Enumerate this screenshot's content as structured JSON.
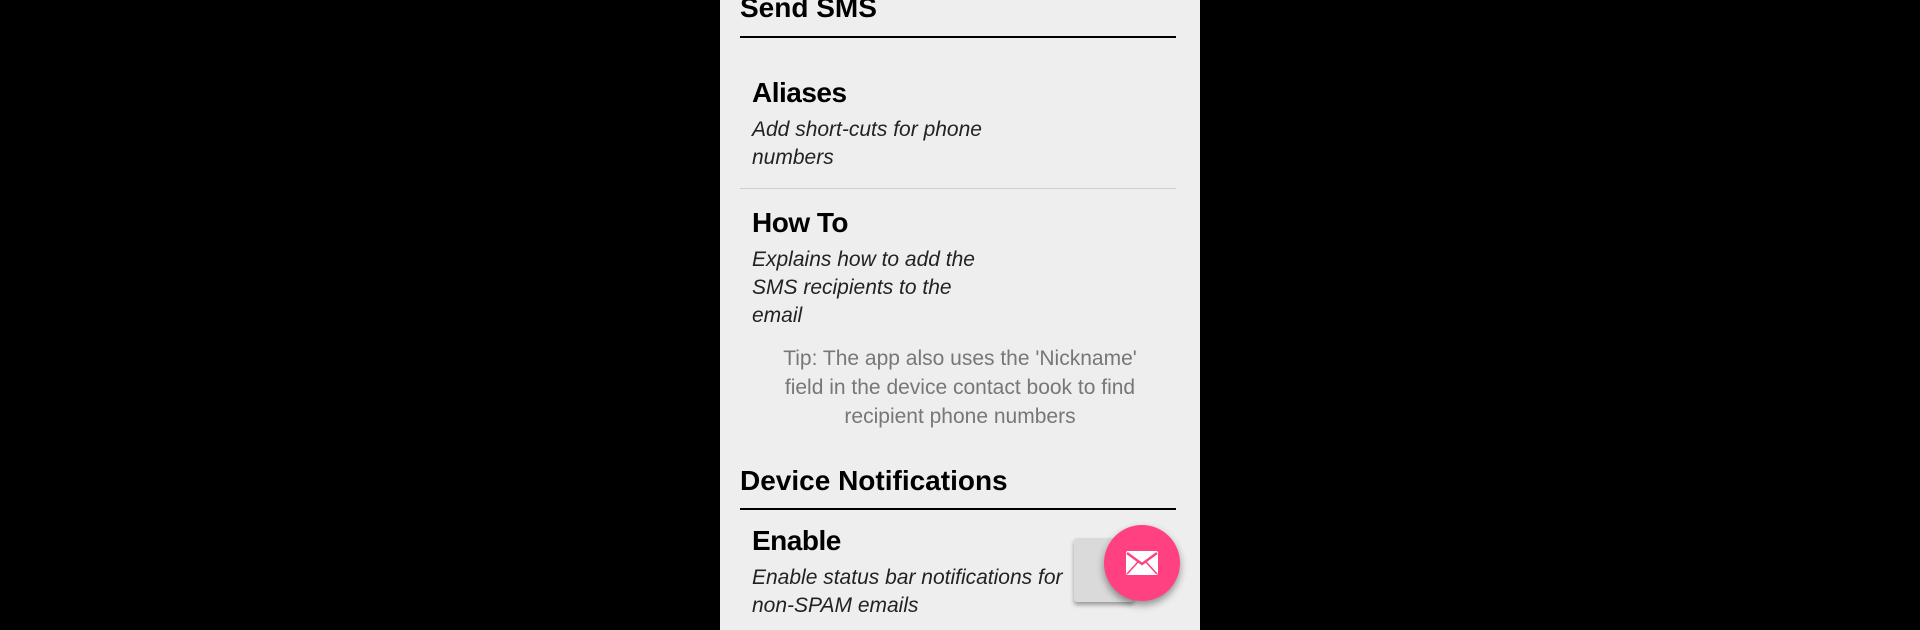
{
  "sections": {
    "send_sms": {
      "title": "Send SMS"
    },
    "device_notifications": {
      "title": "Device Notifications"
    }
  },
  "prefs": {
    "aliases": {
      "title": "Aliases",
      "summary": "Add short-cuts for phone numbers"
    },
    "how_to": {
      "title": "How To",
      "summary": "Explains how to add the SMS recipients to the email"
    },
    "enable": {
      "title": "Enable",
      "summary": "Enable status bar notifications for non-SPAM emails",
      "checked": false
    }
  },
  "tip": "Tip: The app also uses the 'Nickname' field in the device contact book to find recipient phone numbers",
  "fab": {
    "icon": "email-icon"
  },
  "colors": {
    "accent": "#ff4081",
    "background": "#eeeeee",
    "frame": "#000000"
  }
}
